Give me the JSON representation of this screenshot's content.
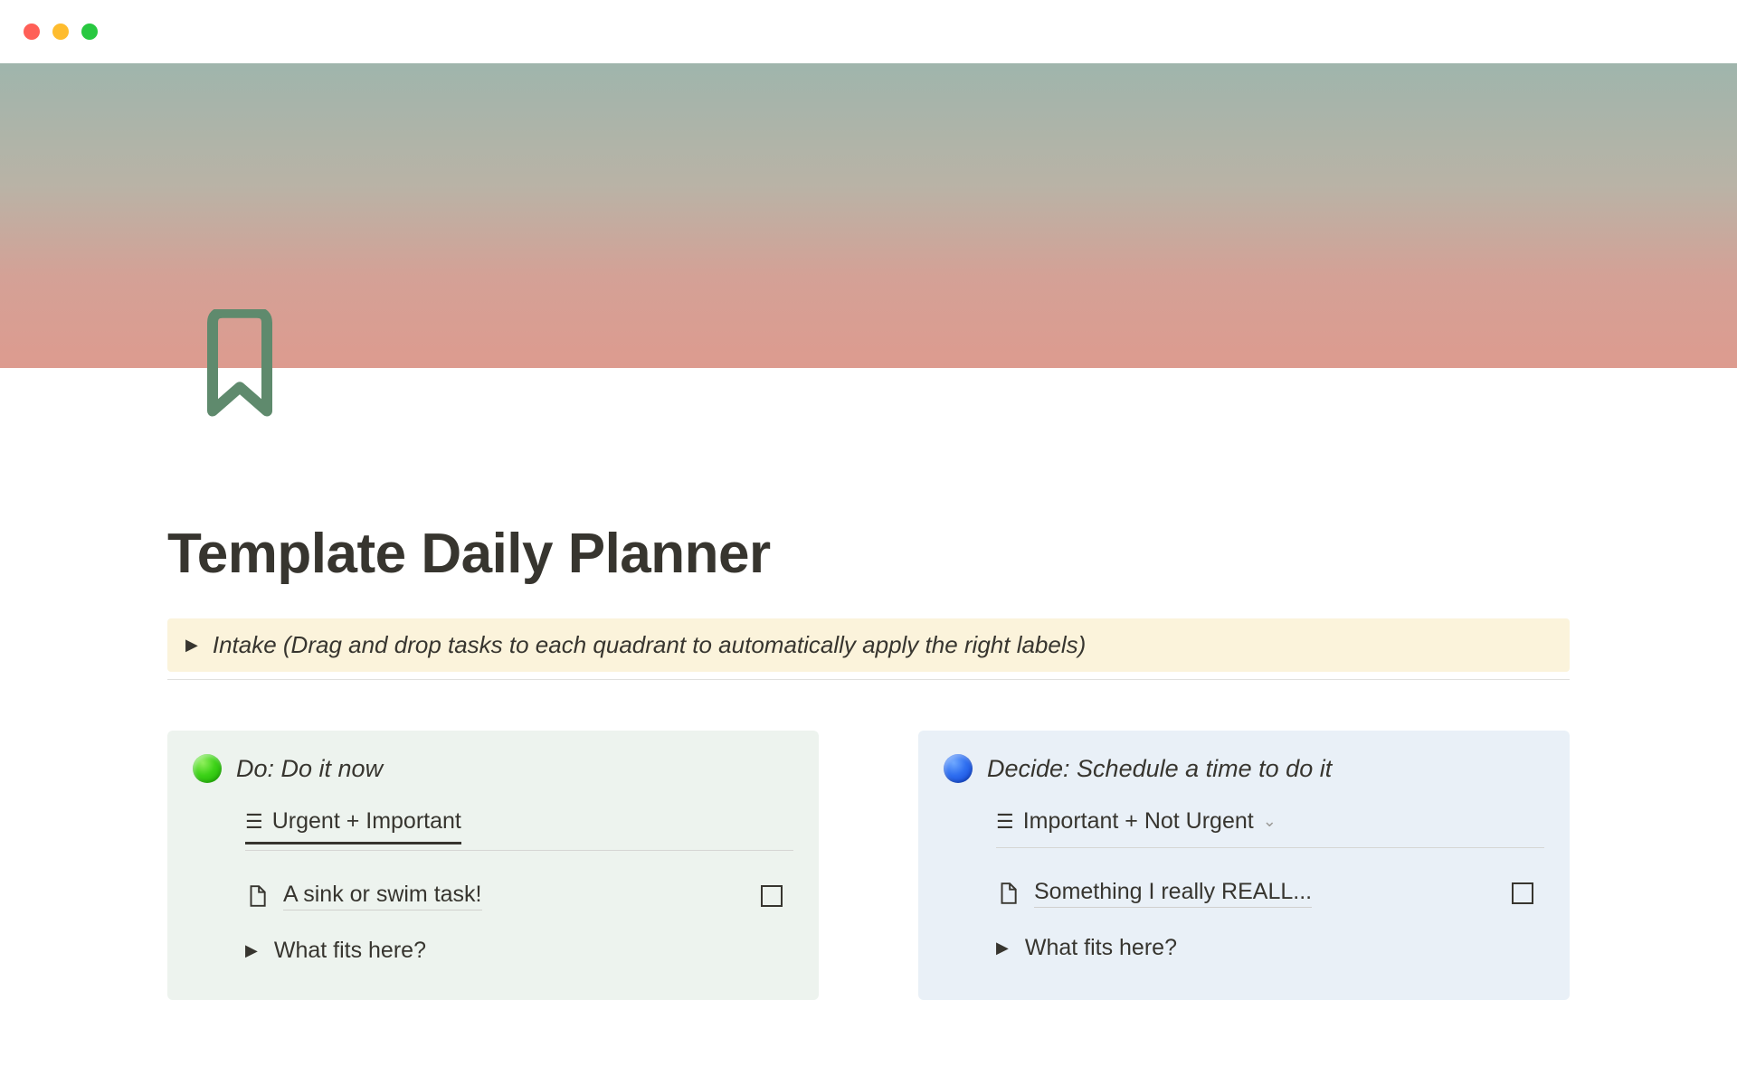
{
  "page": {
    "title": "Template Daily Planner",
    "icon_color": "#5f8a6d"
  },
  "intake": {
    "text": "Intake (Drag and drop tasks to each quadrant to automatically apply the right labels)"
  },
  "quadrants": [
    {
      "dot_color": "green",
      "title": "Do: Do it now",
      "view_name": "Urgent + Important",
      "show_chevron": false,
      "task": "A sink or swim task!",
      "toggle_label": "What fits here?"
    },
    {
      "dot_color": "blue",
      "title": "Decide: Schedule a time to do it",
      "view_name": "Important + Not Urgent",
      "show_chevron": true,
      "task": "Something I really REALL...",
      "toggle_label": "What fits here?"
    }
  ]
}
